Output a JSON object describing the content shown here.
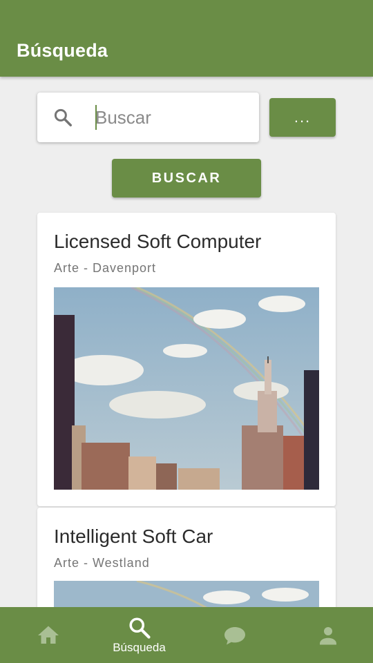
{
  "appbar": {
    "title": "Búsqueda"
  },
  "search": {
    "placeholder": "Buscar",
    "value": ""
  },
  "buttons": {
    "more_label": "...",
    "search_label": "BUSCAR"
  },
  "results": [
    {
      "title": "Licensed Soft Computer",
      "subtitle": "Arte - Davenport",
      "image": "city-skyline-rainbow"
    },
    {
      "title": "Intelligent Soft Car",
      "subtitle": "Arte - Westland",
      "image": "city-skyline-rainbow"
    }
  ],
  "bottom_nav": {
    "items": [
      {
        "icon": "home-icon",
        "label": "",
        "active": false
      },
      {
        "icon": "search-icon",
        "label": "Búsqueda",
        "active": true
      },
      {
        "icon": "chat-icon",
        "label": "",
        "active": false
      },
      {
        "icon": "person-icon",
        "label": "",
        "active": false
      }
    ]
  },
  "colors": {
    "primary": "#6a8d46",
    "background": "#eeeeee",
    "inactive_icon": "#a9bf94"
  }
}
